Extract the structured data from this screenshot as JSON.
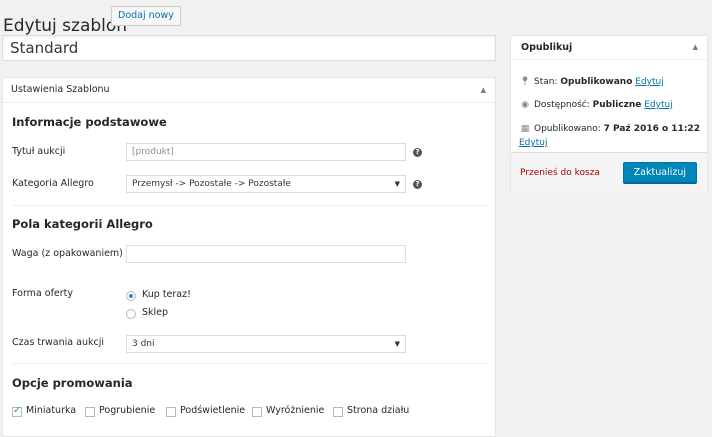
{
  "header": {
    "title": "Edytuj szablon",
    "add_new": "Dodaj nowy"
  },
  "post_title": "Standard",
  "settings_box": {
    "heading": "Ustawienia Szablonu",
    "basic": {
      "heading": "Informacje podstawowe",
      "auction_title_label": "Tytuł aukcji",
      "auction_title_placeholder": "[produkt]",
      "category_label": "Kategoria Allegro",
      "category_value": "Przemysł -> Pozostałe -> Pozostałe"
    },
    "category_fields": {
      "heading": "Pola kategorii Allegro",
      "weight_label": "Waga (z opakowaniem)",
      "weight_value": "",
      "offer_form_label": "Forma oferty",
      "offer_options": [
        "Kup teraz!",
        "Sklep"
      ],
      "offer_selected": "Kup teraz!",
      "duration_label": "Czas trwania aukcji",
      "duration_value": "3 dni"
    },
    "promotion": {
      "heading": "Opcje promowania",
      "options": [
        {
          "label": "Miniaturka",
          "checked": true
        },
        {
          "label": "Pogrubienie",
          "checked": false
        },
        {
          "label": "Podświetlenie",
          "checked": false
        },
        {
          "label": "Wyróżnienie",
          "checked": false
        },
        {
          "label": "Strona działu",
          "checked": false
        }
      ]
    }
  },
  "publish_box": {
    "heading": "Opublikuj",
    "status_label": "Stan:",
    "status_value": "Opublikowano",
    "status_edit": "Edytuj",
    "visibility_label": "Dostępność:",
    "visibility_value": "Publiczne",
    "visibility_edit": "Edytuj",
    "published_label": "Opublikowano:",
    "published_value": "7 Paź 2016 o 11:22",
    "published_edit": "Edytuj",
    "trash": "Przenieś do kosza",
    "update": "Zaktualizuj"
  },
  "icons": {
    "help": "help-icon",
    "pin": "pin-icon",
    "eye": "eye-icon",
    "calendar": "calendar-icon",
    "collapse": "collapse-arrow-icon"
  },
  "colors": {
    "accent": "#0085ba",
    "link": "#0073aa",
    "trash": "#aa0000"
  }
}
